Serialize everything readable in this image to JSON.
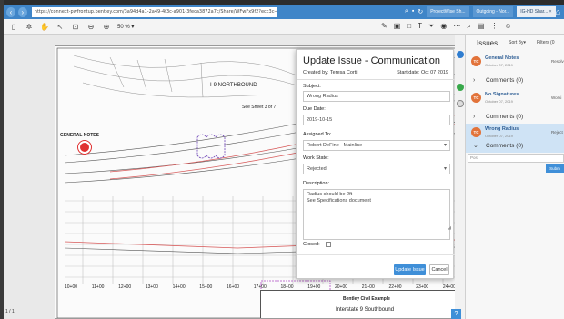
{
  "browser": {
    "url": "https://connect-pwfrontup.bentley.com/3a94d4a1-2a49-4f3c-a901-3feca3872a7c/Share/WFwFx9f2?ecc3c-4425-a825-a0161a53742",
    "tabs": [
      {
        "label": "ProjectWise Sh...",
        "active": false
      },
      {
        "label": "Outgoing - Nor...",
        "active": false
      },
      {
        "label": "IG-HD Shar... ×",
        "active": true
      }
    ]
  },
  "toolbar": {
    "zoom": "50 % ▾"
  },
  "drawing": {
    "northbound_label": "I-9 NORTHBOUND",
    "see_sheet": "See Sheet 3 of 7",
    "general_notes": "GENERAL NOTES",
    "titleblock_client": "Bentley Civil Example",
    "titleblock_project": "Interstate 9 Southbound",
    "stations": [
      "10+00",
      "11+00",
      "12+00",
      "13+00",
      "14+00",
      "15+00",
      "16+00",
      "17+00",
      "18+00",
      "19+00",
      "20+00",
      "21+00",
      "22+00",
      "23+00",
      "24+00"
    ],
    "page_indicator": "1 / 1"
  },
  "dialog": {
    "title": "Update Issue - Communication",
    "created_by": "Created by: Teresa Corti",
    "start_date": "Start date: Oct 07 2019",
    "subject_label": "Subject:",
    "subject_value": "Wrong Radius",
    "due_date_label": "Due Date:",
    "due_date_value": "2019-10-15",
    "assigned_label": "Assigned To:",
    "assigned_value": "Robert DeFine - Mainline",
    "workstate_label": "Work State:",
    "workstate_value": "Rejected",
    "description_label": "Description:",
    "description_value": "Radius should be 2ft\nSee Specifications document",
    "closed_label": "Closed:",
    "update_button": "Update Issue",
    "cancel_button": "Cancel"
  },
  "panel": {
    "title": "Issues",
    "sort": "Sort By▾",
    "filters": "Filters (0",
    "issues": [
      {
        "initials": "TC",
        "title": "General Notes",
        "date": "October 07, 2019",
        "status": "Resolv",
        "comments": "Comments (0)",
        "chevron": "›",
        "selected": false
      },
      {
        "initials": "TC",
        "title": "No Signatures",
        "date": "October 07, 2019",
        "status": "Worki",
        "comments": "Comments (0)",
        "chevron": "›",
        "selected": false
      },
      {
        "initials": "TC",
        "title": "Wrong Radius",
        "date": "October 07, 2019",
        "status": "Reject",
        "comments": "Comments (0)",
        "chevron": "⌄",
        "selected": true
      }
    ],
    "comment_placeholder": "Post",
    "submit": "Subm"
  },
  "help": "?"
}
